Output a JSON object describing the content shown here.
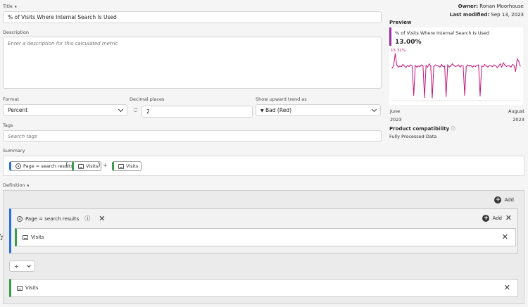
{
  "owner": {
    "label": "Owner:",
    "name": "Ronan Moorhouse"
  },
  "last_modified": {
    "label": "Last modified:",
    "value": "Sep 13, 2023"
  },
  "title_field": {
    "label": "Title",
    "required_mark": "★",
    "value": "% of Visits Where Internal Search Is Used"
  },
  "description_field": {
    "label": "Description",
    "placeholder": "Enter a description for this calculated metric"
  },
  "format_field": {
    "label": "Format",
    "value": "Percent"
  },
  "decimal_field": {
    "label": "Decimal places",
    "value": "2"
  },
  "trend_field": {
    "label": "Show upward trend as",
    "value": "Bad (Red)",
    "marker": "▼"
  },
  "tags_field": {
    "label": "Tags",
    "placeholder": "Search tags"
  },
  "summary": {
    "label": "Summary",
    "segment": "Page = search results",
    "open_paren": "(",
    "metric1": "Visits",
    "close_paren": ")",
    "operator": "÷",
    "metric2": "Visits"
  },
  "preview": {
    "label": "Preview",
    "metric_name": "% of Visits Where Internal Search Is Used",
    "value": "13.00%",
    "peak_label": "15.31%",
    "x_start": "June",
    "x_start_year": "2023",
    "x_end": "August",
    "x_end_year": "2023",
    "line_color": "#c2157a",
    "accent_color": "#9b2ca8"
  },
  "product_compat": {
    "label": "Product compatibility",
    "value": "Fully Processed Data"
  },
  "definition": {
    "label": "Definition",
    "required_mark": "★",
    "add_label": "Add",
    "container_segment": "Page = search results",
    "container_add_label": "Add",
    "inner_metric": "Visits",
    "operator": "÷",
    "bottom_metric": "Visits"
  },
  "chart_data": {
    "type": "line",
    "xlabel": "",
    "ylabel": "",
    "x": [
      "June 2023",
      "August 2023"
    ],
    "series": [
      {
        "values": [
          12.6,
          13.1,
          15.31,
          13.2,
          12.8,
          13.0,
          12.9,
          13.3,
          13.0,
          12.7,
          13.1,
          12.9,
          13.2,
          13.0,
          7.5,
          13.1,
          12.8,
          13.0,
          12.9,
          13.2,
          13.0,
          7.1,
          13.1,
          12.8,
          13.4,
          13.0,
          7.0,
          12.9,
          13.2,
          13.1,
          13.0,
          12.8,
          13.3,
          12.9,
          13.0,
          7.3,
          13.2,
          12.8,
          13.0,
          13.4,
          13.1,
          12.9,
          13.0,
          13.2,
          12.8,
          13.1,
          13.0,
          7.5,
          12.9,
          13.2,
          13.0,
          13.1,
          12.8,
          13.0,
          12.9,
          13.1,
          13.2,
          7.4,
          13.0,
          12.9,
          13.3,
          13.0,
          12.8,
          13.1,
          13.0,
          12.9,
          13.2,
          13.1,
          12.7,
          13.0,
          13.4,
          12.8,
          13.6,
          13.2,
          12.9,
          13.1,
          13.0,
          12.8,
          13.3,
          13.1,
          12.0,
          14.3,
          13.9,
          13.0
        ]
      }
    ],
    "ylim": [
      6.5,
      16
    ]
  }
}
